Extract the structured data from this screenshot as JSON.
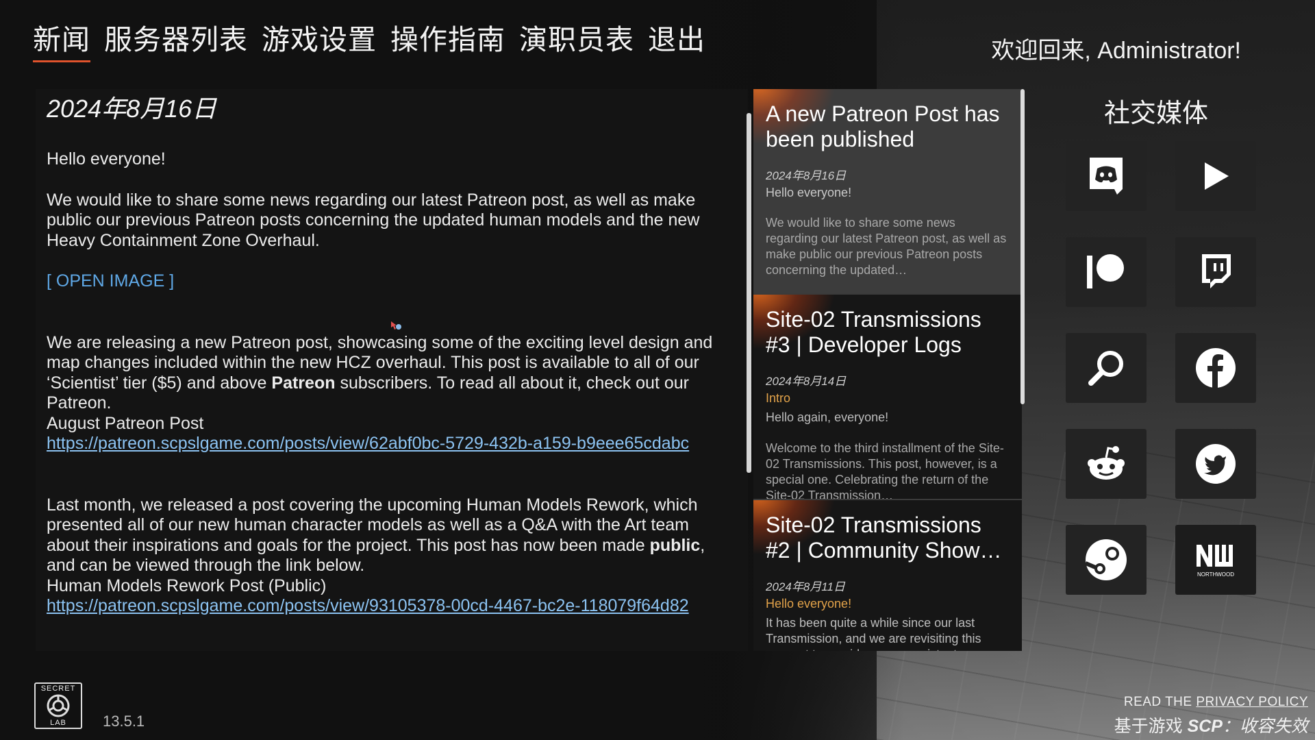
{
  "nav": {
    "items": [
      "新闻",
      "服务器列表",
      "游戏设置",
      "操作指南",
      "演职员表",
      "退出"
    ],
    "active": "新闻"
  },
  "welcome": "欢迎回来, Administrator!",
  "article": {
    "date": "2024年8月16日",
    "greeting": "Hello everyone!",
    "para1": "We would like to share some news regarding our latest Patreon post, as well as make public our previous Patreon posts concerning the updated human models and the new Heavy Containment Zone Overhaul.",
    "open_image": "[ OPEN IMAGE ]",
    "para2_a": "We are releasing a new Patreon post, showcasing some of the exciting level design and map changes included within the new HCZ overhaul. This post is available to all of our ‘Scientist’ tier ($5) and above ",
    "para2_bold": "Patreon",
    "para2_b": " subscribers. To read all about it, check out our Patreon.",
    "link1_label": "August Patreon Post",
    "link1_url": "https://patreon.scpslgame.com/posts/view/62abf0bc-5729-432b-a159-b9eee65cdabc",
    "para3_a": "Last month, we released a post covering the upcoming Human Models Rework, which presented all of our new human character models as well as a Q&A with the Art team about their inspirations and goals for the project. This post has now been made ",
    "para3_bold": "public",
    "para3_b": ", and can be viewed through the link below.",
    "link2_label": "Human Models Rework Post (Public)",
    "link2_url": "https://patreon.scpslgame.com/posts/view/93105378-00cd-4467-bc2e-118079f64d82"
  },
  "news_cards": [
    {
      "title": "A new Patreon Post has been published",
      "date": "2024年8月16日",
      "sub": "Hello everyone!",
      "body": "",
      "body2": "We would like to share some news regarding our latest Patreon post, as well as make public our previous Patreon posts concerning the updated…"
    },
    {
      "title": "Site-02 Transmissions #3 | Developer Logs",
      "date": "2024年8月14日",
      "sub": "Intro",
      "body": "Hello again, everyone!",
      "body2": "Welcome to the third installment of the Site-02 Transmissions. This post, however, is a special one. Celebrating the return of the Site-02 Transmission…"
    },
    {
      "title": "Site-02 Transmissions #2 | Community Show…",
      "date": "2024年8月11日",
      "sub": "Hello everyone!",
      "body": "It has been quite a while since our last Transmission, and we are revisiting this concept to provide more consistent",
      "body2": ""
    }
  ],
  "social": {
    "title": "社交媒体",
    "icons": [
      "discord-icon",
      "youtube-icon",
      "patreon-icon",
      "twitch-icon",
      "search-icon",
      "facebook-icon",
      "reddit-icon",
      "twitter-icon",
      "steam-icon",
      "northwood-icon"
    ],
    "northwood_text": "NORTHWOOD"
  },
  "logo": {
    "top": "SECRET",
    "bottom": "LAB"
  },
  "version": "13.5.1",
  "privacy": {
    "prefix": "READ THE ",
    "link": "PRIVACY POLICY"
  },
  "based_on": {
    "prefix": "基于游戏 ",
    "scp": "SCP",
    "suffix": "：收容失效"
  }
}
